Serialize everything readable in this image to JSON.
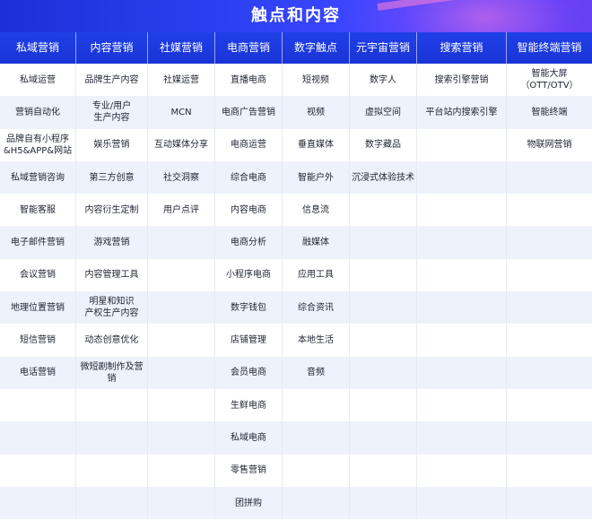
{
  "title": "触点和内容",
  "columns": [
    {
      "header": "私域营销",
      "items": [
        "私域运营",
        "营销自动化",
        "品牌自有小程序\n&H5&APP&网站",
        "私域营销咨询",
        "智能客服",
        "电子邮件营销",
        "会议营销",
        "地理位置营销",
        "短信营销",
        "电话营销"
      ]
    },
    {
      "header": "内容营销",
      "items": [
        "品牌生产内容",
        "专业/用户\n生产内容",
        "娱乐营销",
        "第三方创意",
        "内容衍生定制",
        "游戏营销",
        "内容管理工具",
        "明星和知识\n产权生产内容",
        "动态创意优化",
        "微短剧制作及营销"
      ]
    },
    {
      "header": "社媒营销",
      "items": [
        "社媒运营",
        "MCN",
        "互动媒体分享",
        "社交洞察",
        "用户点评"
      ]
    },
    {
      "header": "电商营销",
      "items": [
        "直播电商",
        "电商广告营销",
        "电商运营",
        "综合电商",
        "内容电商",
        "电商分析",
        "小程序电商",
        "数字钱包",
        "店铺管理",
        "会员电商",
        "生鲜电商",
        "私域电商",
        "零售营销",
        "团拼购"
      ]
    },
    {
      "header": "数字触点",
      "items": [
        "短视频",
        "视频",
        "垂直媒体",
        "智能户外",
        "信息流",
        "融媒体",
        "应用工具",
        "综合资讯",
        "本地生活",
        "音频"
      ]
    },
    {
      "header": "元宇宙营销",
      "items": [
        "数字人",
        "虚拟空间",
        "数字藏品",
        "沉浸式体验技术"
      ]
    },
    {
      "header": "搜索营销",
      "items": [
        "搜索引擎营销",
        "平台站内搜索引擎"
      ]
    },
    {
      "header": "智能终端营销",
      "items": [
        "智能大屏\n（OTT/OTV）",
        "智能终端",
        "物联网营销"
      ]
    }
  ]
}
